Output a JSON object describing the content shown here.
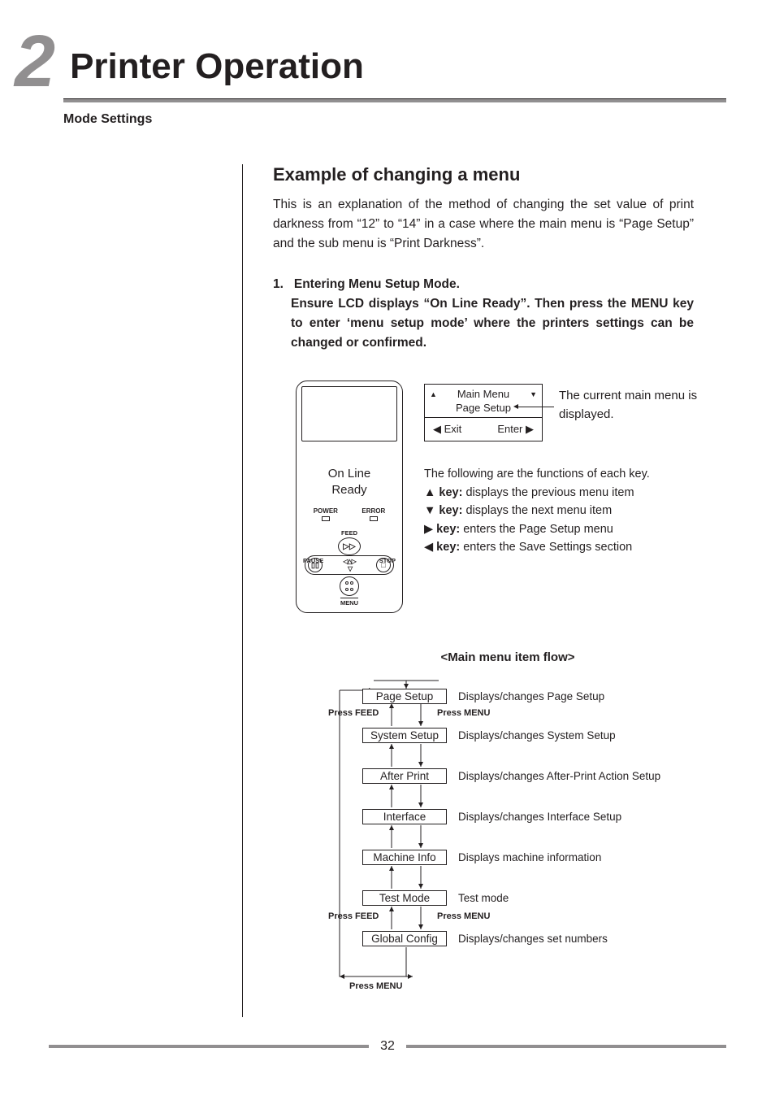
{
  "header": {
    "chapter_number": "2",
    "chapter_title": "Printer Operation",
    "subtitle": "Mode Settings"
  },
  "section": {
    "title": "Example of changing a menu",
    "intro": "This is an explanation of the method of changing the set value of print darkness from “12” to “14” in a case where the main menu is “Page Setup” and the sub menu is “Print Darkness”."
  },
  "step1": {
    "number": "1.",
    "title": "Entering Menu Setup Mode.",
    "body": "Ensure LCD displays “On Line Ready”. Then press the MENU key to enter ‘menu setup mode’ where the printers settings can be changed or confirmed."
  },
  "printer": {
    "status_line1": "On Line",
    "status_line2": "Ready",
    "power_label": "POWER",
    "error_label": "ERROR",
    "feed_label": "FEED",
    "pause_label": "PAUSE",
    "stop_label": "STOP",
    "menu_label": "MENU"
  },
  "lcd": {
    "line1_left": "▲",
    "line1_mid": "Main Menu",
    "line1_right": "▼",
    "line2": "Page Setup",
    "bot_left": "◀ Exit",
    "bot_right": "Enter ▶",
    "caption": "The current main menu is displayed."
  },
  "keyfuncs": {
    "intro": "The following are the functions of each key.",
    "items": [
      {
        "sym": "▲",
        "bold": " key:",
        "text": " displays the previous menu item"
      },
      {
        "sym": "▼",
        "bold": " key:",
        "text": " displays the next menu item"
      },
      {
        "sym": "▶",
        "bold": " key:",
        "text": " enters the Page Setup menu"
      },
      {
        "sym": "◀",
        "bold": " key:",
        "text": " enters the Save Settings section"
      }
    ]
  },
  "flow": {
    "title": "<Main menu item flow>",
    "press_feed": "Press FEED",
    "press_menu": "Press MENU",
    "items": [
      {
        "name": "Page Setup",
        "desc": "Displays/changes Page Setup"
      },
      {
        "name": "System Setup",
        "desc": "Displays/changes System Setup"
      },
      {
        "name": "After Print",
        "desc": "Displays/changes After-Print Action Setup"
      },
      {
        "name": "Interface",
        "desc": "Displays/changes Interface Setup"
      },
      {
        "name": "Machine Info",
        "desc": "Displays machine information"
      },
      {
        "name": "Test Mode",
        "desc": "Test mode"
      },
      {
        "name": "Global Config",
        "desc": "Displays/changes set numbers"
      }
    ]
  },
  "footer": {
    "page": "32"
  }
}
